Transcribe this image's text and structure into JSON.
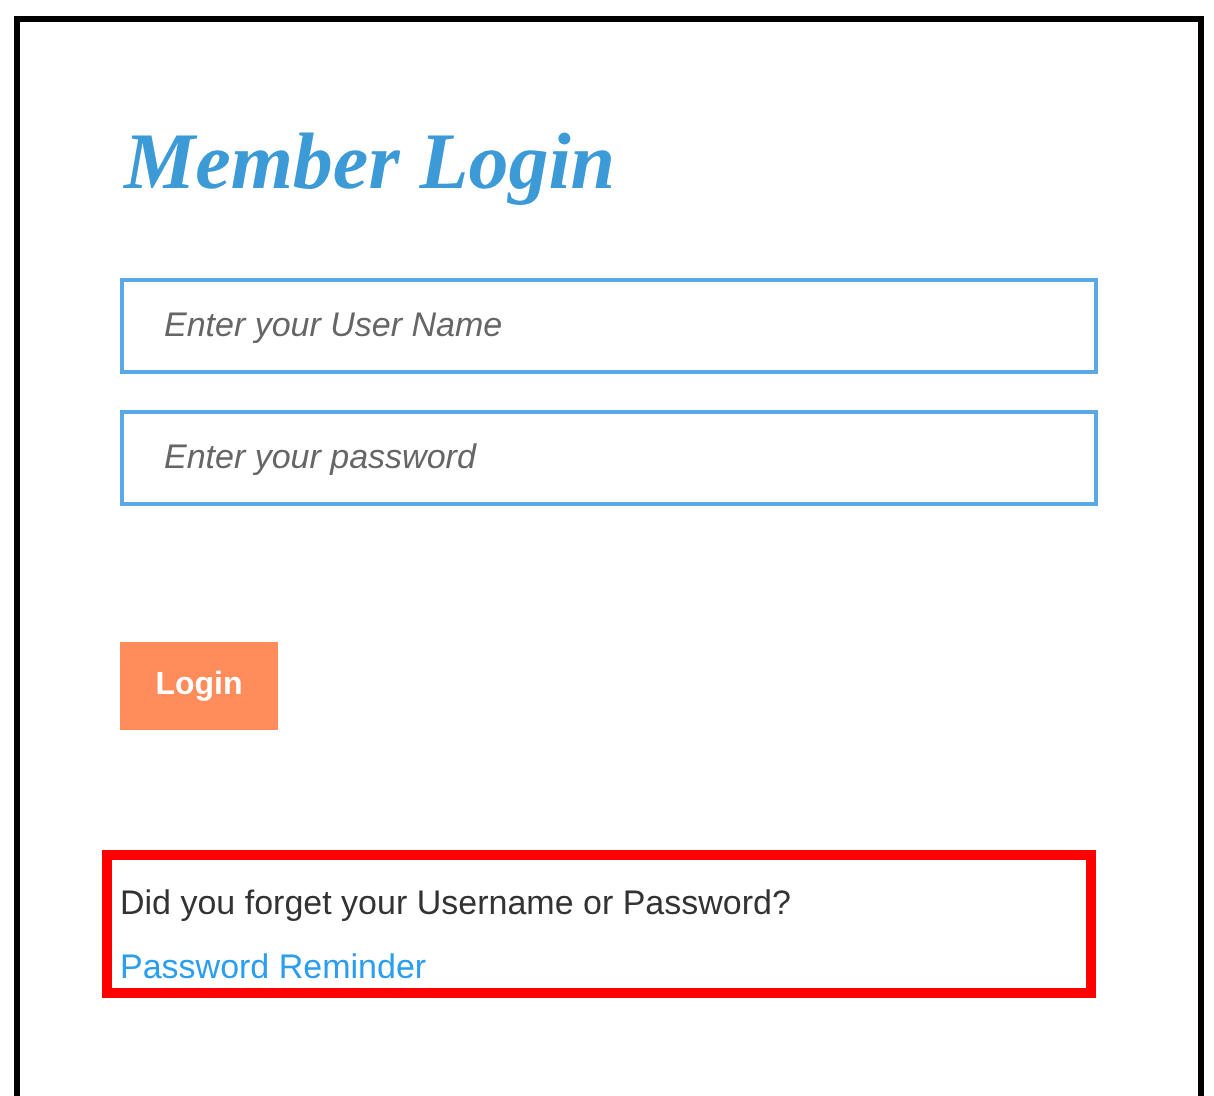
{
  "title": "Member Login",
  "fields": [
    {
      "placeholder": "Enter your User Name"
    },
    {
      "placeholder": "Enter your password"
    }
  ],
  "login_button": "Login",
  "reminder": {
    "text": "Did you forget your Username or Password?",
    "link": "Password Reminder"
  }
}
